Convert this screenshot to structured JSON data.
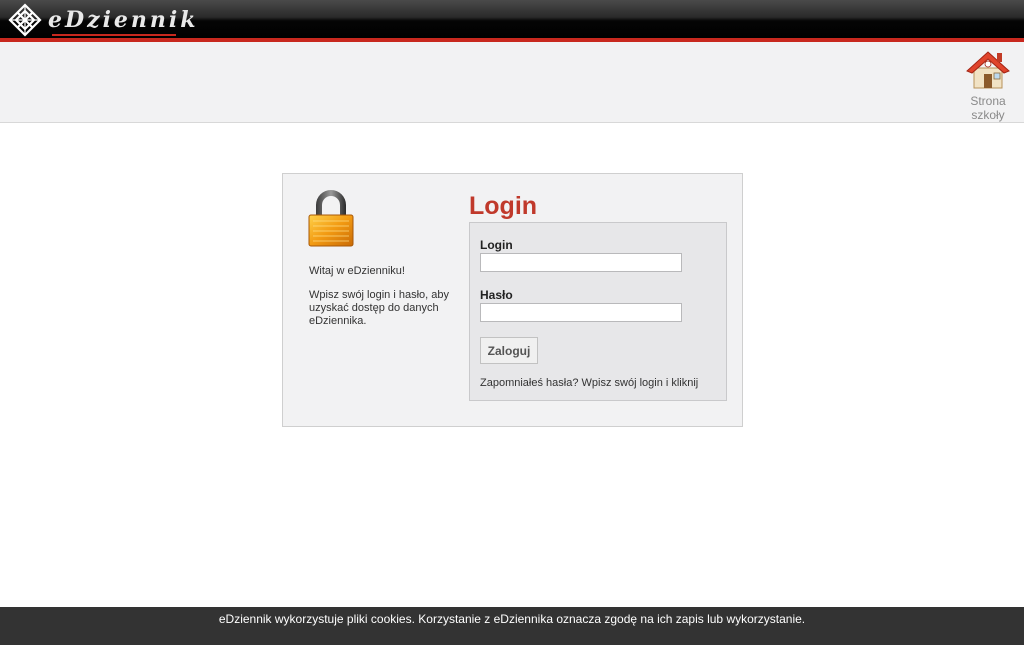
{
  "header": {
    "logo_text": "eDziennik",
    "home_link": {
      "label_line1": "Strona",
      "label_line2": "szkoły"
    }
  },
  "login_panel": {
    "welcome": "Witaj w eDzienniku!",
    "description": "Wpisz swój login i hasło, aby uzyskać dostęp do danych eDziennika.",
    "title": "Login",
    "login_label": "Login",
    "login_value": "",
    "password_label": "Hasło",
    "password_value": "",
    "submit_label": "Zaloguj",
    "forgot_text": "Zapomniałeś hasła? Wpisz swój login i kliknij"
  },
  "cookie_notice": "eDziennik wykorzystuje pliki cookies. Korzystanie z eDziennika oznacza zgodę na ich zapis lub wykorzystanie.",
  "colors": {
    "accent_red": "#c0392b",
    "topbar_red": "#c8281e",
    "cookie_bar": "#333333"
  },
  "icons": [
    "logo-mark-icon",
    "home-icon",
    "lock-icon"
  ]
}
